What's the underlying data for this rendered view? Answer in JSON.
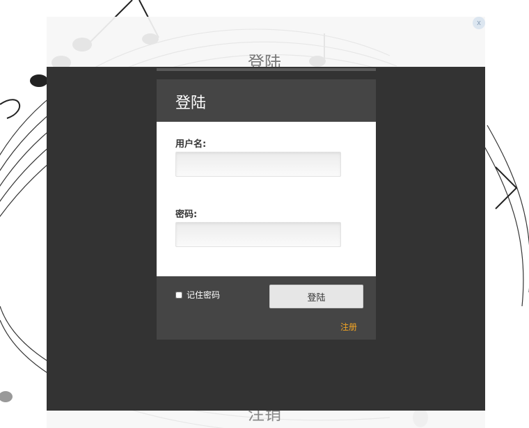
{
  "background_panel": {
    "title": "登陆",
    "close_label": "x",
    "bottom_label": "注销"
  },
  "modal": {
    "title": "登陆",
    "username_label": "用户名:",
    "username_value": "",
    "password_label": "密码:",
    "password_value": "",
    "remember_label": "记住密码",
    "remember_checked": false,
    "login_button": "登陆",
    "register_link": "注册"
  },
  "colors": {
    "overlay": "#333333",
    "modal_header": "#454545",
    "register_link": "#f5a623"
  },
  "icons": [
    "close-icon",
    "music-notes-decoration"
  ]
}
